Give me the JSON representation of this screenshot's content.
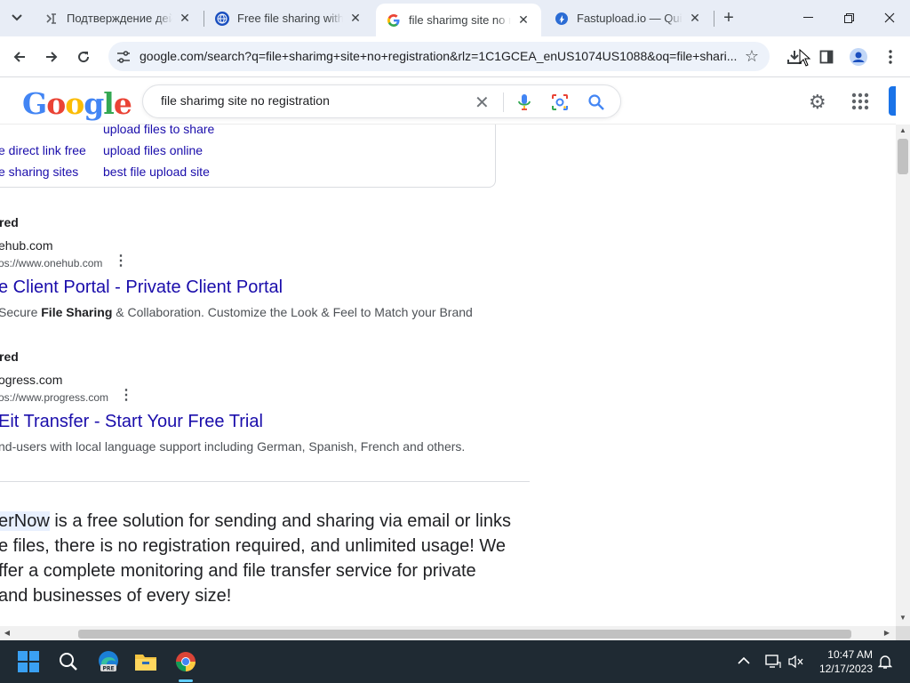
{
  "browser": {
    "tabs": [
      {
        "title": "Подтверждение дейст",
        "active": false
      },
      {
        "title": "Free file sharing witho",
        "active": false
      },
      {
        "title": "file sharimg site no reg",
        "active": true
      },
      {
        "title": "Fastupload.io — Quick",
        "active": false
      }
    ],
    "url": "google.com/search?q=file+sharimg+site+no+registration&rlz=1C1GCEA_enUS1074US1088&oq=file+shari..."
  },
  "search": {
    "query": "file sharimg site no registration"
  },
  "related_searches": [
    {
      "text": "upload files to share"
    },
    {
      "text": "e direct link free"
    },
    {
      "text": "upload files online"
    },
    {
      "text": "e sharing sites"
    },
    {
      "text": "best file upload site"
    }
  ],
  "ads": [
    {
      "label": "red",
      "site_name": "ehub.com",
      "site_url": "os://www.onehub.com",
      "title": "e Client Portal - Private Client Portal",
      "desc_prefix": "Secure ",
      "desc_bold": "File Sharing",
      "desc_suffix": " & Collaboration. Customize the Look & Feel to Match your Brand"
    },
    {
      "label": "red",
      "site_name": "ogress.com",
      "site_url": "os://www.progress.com",
      "title": "Eit Transfer - Start Your Free Trial",
      "desc": "nd-users with local language support including German, Spanish, French and others."
    }
  ],
  "snippet": {
    "highlight": "erNow",
    "line1_rest": " is a free solution for sending and sharing via email or links",
    "line2": "e files, there is no registration required, and unlimited usage! We",
    "line3": "ffer a complete monitoring and file transfer service for private",
    "line4": "and businesses of every size!"
  },
  "taskbar": {
    "time": "10:47 AM",
    "date": "12/17/2023"
  },
  "colors": {
    "link": "#1a0dab",
    "accent": "#1a73e8",
    "taskbar_bg": "#1f2a33"
  }
}
